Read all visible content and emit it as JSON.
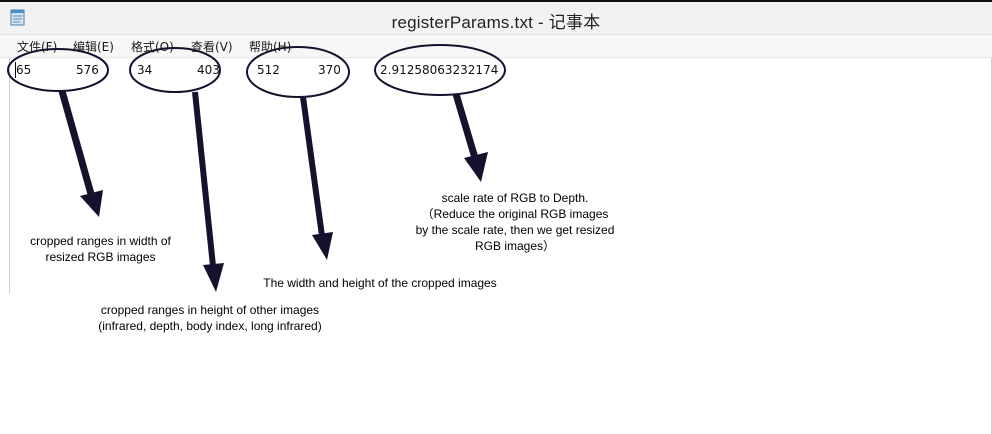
{
  "window": {
    "title": "registerParams.txt - 记事本"
  },
  "menu": {
    "file": "文件(F)",
    "edit": "编辑(E)",
    "format": "格式(O)",
    "view": "查看(V)",
    "help": "帮助(H)"
  },
  "content": {
    "values": [
      "65",
      "576",
      "34",
      "403",
      "512",
      "370",
      "2.91258063232174"
    ]
  },
  "annotations": {
    "width_range": [
      "cropped ranges in width of",
      "resized RGB images"
    ],
    "height_range": [
      "cropped ranges in height of other images",
      "(infrared, depth, body index, long infrared)"
    ],
    "crop_size": "The width and height of the cropped images",
    "scale_rate": [
      "scale rate of RGB to Depth.",
      "（Reduce the original RGB images",
      "by the scale rate, then we get resized",
      "RGB images）"
    ]
  },
  "colors": {
    "arrow": "#15122e",
    "ellipse": "#15122e"
  },
  "icons": {
    "app": "notepad-icon"
  }
}
